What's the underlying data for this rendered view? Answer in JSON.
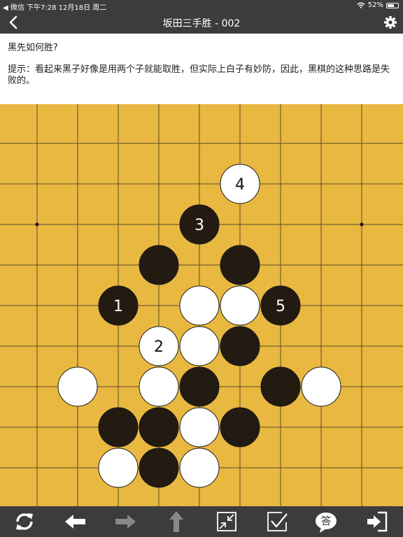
{
  "status_bar": {
    "left": "◀ 微信   下午7:28   12月18日 周二",
    "battery": "52%"
  },
  "nav": {
    "title": "坂田三手胜 - 002",
    "back_icon": "chevron-left-icon",
    "settings_icon": "gear-icon"
  },
  "problem": {
    "question": "黑先如何胜?",
    "hint": "提示：看起来黑子好像是用两个子就能取胜，但实际上白子有妙防，因此，黑棋的这种思路是失败的。"
  },
  "board": {
    "colors": {
      "wood": "#e8b840",
      "line": "#5a4a2a",
      "black": "#231a12",
      "white": "#ffffff"
    },
    "star_points": [
      [
        0,
        2
      ],
      [
        8,
        2
      ]
    ],
    "stones": [
      {
        "color": "white",
        "col": 5,
        "row": 1,
        "label": "4"
      },
      {
        "color": "black",
        "col": 4,
        "row": 2,
        "label": "3"
      },
      {
        "color": "black",
        "col": 3,
        "row": 3,
        "label": ""
      },
      {
        "color": "black",
        "col": 5,
        "row": 3,
        "label": ""
      },
      {
        "color": "black",
        "col": 2,
        "row": 4,
        "label": "1"
      },
      {
        "color": "white",
        "col": 4,
        "row": 4,
        "label": ""
      },
      {
        "color": "white",
        "col": 5,
        "row": 4,
        "label": ""
      },
      {
        "color": "black",
        "col": 6,
        "row": 4,
        "label": "5"
      },
      {
        "color": "white",
        "col": 3,
        "row": 5,
        "label": "2"
      },
      {
        "color": "white",
        "col": 4,
        "row": 5,
        "label": ""
      },
      {
        "color": "black",
        "col": 5,
        "row": 5,
        "label": ""
      },
      {
        "color": "white",
        "col": 1,
        "row": 6,
        "label": ""
      },
      {
        "color": "white",
        "col": 3,
        "row": 6,
        "label": ""
      },
      {
        "color": "black",
        "col": 4,
        "row": 6,
        "label": ""
      },
      {
        "color": "black",
        "col": 6,
        "row": 6,
        "label": ""
      },
      {
        "color": "white",
        "col": 7,
        "row": 6,
        "label": ""
      },
      {
        "color": "black",
        "col": 2,
        "row": 7,
        "label": ""
      },
      {
        "color": "black",
        "col": 3,
        "row": 7,
        "label": ""
      },
      {
        "color": "white",
        "col": 4,
        "row": 7,
        "label": ""
      },
      {
        "color": "black",
        "col": 5,
        "row": 7,
        "label": ""
      },
      {
        "color": "white",
        "col": 2,
        "row": 8,
        "label": ""
      },
      {
        "color": "black",
        "col": 3,
        "row": 8,
        "label": ""
      },
      {
        "color": "white",
        "col": 4,
        "row": 8,
        "label": ""
      }
    ]
  },
  "toolbar": {
    "buttons": [
      "refresh-icon",
      "arrow-left-icon",
      "arrow-right-icon",
      "arrow-up-icon",
      "collapse-icon",
      "check-icon",
      "answer-icon",
      "exit-icon"
    ],
    "answer_label": "答"
  }
}
